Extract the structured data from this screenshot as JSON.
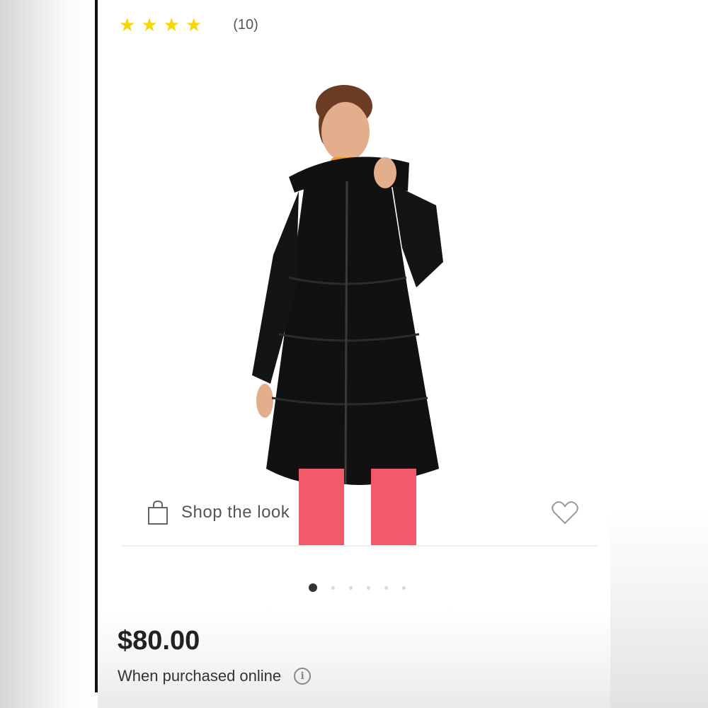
{
  "product": {
    "rating": {
      "stars": 4,
      "review_count": "(10)"
    },
    "image": {
      "icon": "product-photo"
    },
    "shop_the_look": {
      "label": "Shop the look",
      "icon": "shopping-bag-icon"
    },
    "favorite": {
      "icon": "heart-icon"
    },
    "carousel": {
      "total": 6,
      "active_index": 0
    },
    "price": "$80.00",
    "price_note": "When purchased online",
    "price_note_info_icon": "info-icon"
  },
  "colors": {
    "star": "#f5d800",
    "coat": "#111111",
    "pants": "#f25a6b",
    "turtleneck": "#f39a1b"
  }
}
